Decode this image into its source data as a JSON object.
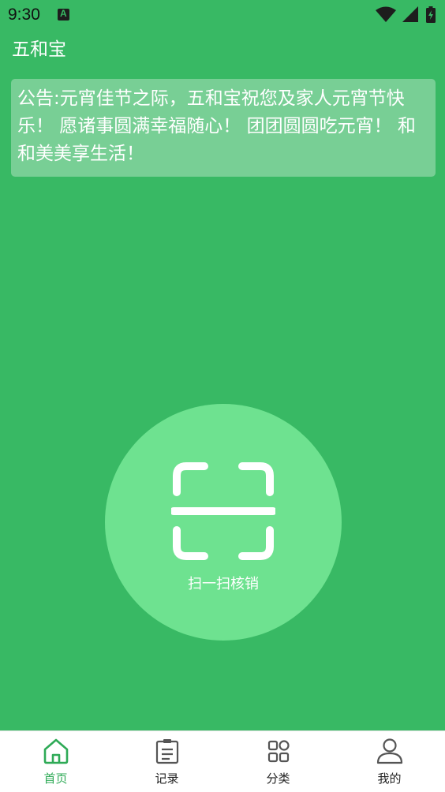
{
  "status_bar": {
    "time": "9:30",
    "icons": [
      "a-notification-icon",
      "wifi-icon",
      "signal-icon",
      "battery-charging-icon"
    ]
  },
  "header": {
    "title": "五和宝"
  },
  "notice": {
    "text": "公告:元宵佳节之际，五和宝祝您及家人元宵节快乐！ 愿诸事圆满幸福随心！ 团团圆圆吃元宵！ 和和美美享生活！"
  },
  "scan": {
    "icon": "scan-icon",
    "label": "扫一扫核销"
  },
  "tabbar": {
    "tabs": [
      {
        "label": "首页",
        "icon": "home-icon",
        "active": true
      },
      {
        "label": "记录",
        "icon": "clipboard-icon",
        "active": false
      },
      {
        "label": "分类",
        "icon": "grid-icon",
        "active": false
      },
      {
        "label": "我的",
        "icon": "user-icon",
        "active": false
      }
    ]
  },
  "colors": {
    "background": "#38b964",
    "scan_circle": "#6ee290",
    "active_tab": "#2eaa56",
    "inactive_tab": "#555555"
  }
}
